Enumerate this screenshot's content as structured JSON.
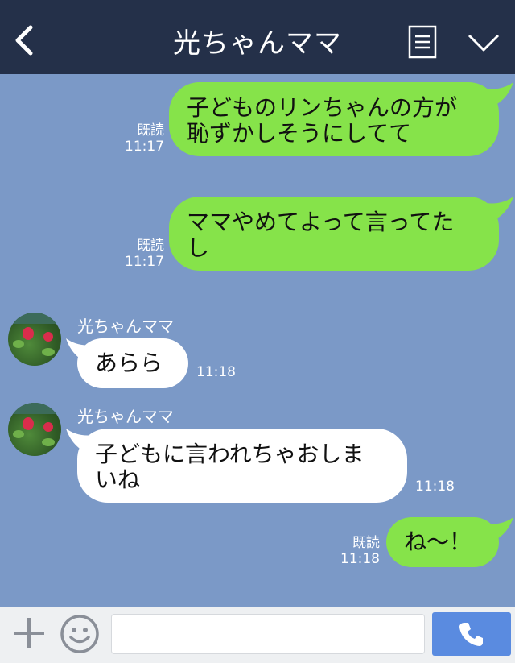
{
  "header": {
    "title": "光ちゃんママ",
    "back_icon": "chevron-left-icon",
    "menu_icon": "list-icon",
    "collapse_icon": "chevron-down-icon",
    "background": "#243049"
  },
  "colors": {
    "chat_background": "#7b99c7",
    "outgoing_bubble": "#86e34a",
    "incoming_bubble": "#ffffff",
    "call_button": "#5a8be0"
  },
  "messages": [
    {
      "direction": "out",
      "line1": "子どものリンちゃんの方が",
      "line2": "恥ずかしそうにしてて",
      "read": "既読",
      "time": "11:17"
    },
    {
      "direction": "out",
      "line1": "ママやめてよって言ってた",
      "line2": "し",
      "read": "既読",
      "time": "11:17"
    },
    {
      "direction": "in",
      "sender": "光ちゃんママ",
      "line1": "あらら",
      "time": "11:18"
    },
    {
      "direction": "in",
      "sender": "光ちゃんママ",
      "line1": "子どもに言われちゃおしま",
      "line2": "いね",
      "time": "11:18"
    },
    {
      "direction": "out",
      "line1": "ね〜！",
      "read": "既読",
      "time": "11:18"
    }
  ],
  "input_bar": {
    "add_icon": "plus-icon",
    "emoji_icon": "smile-icon",
    "message_value": "",
    "call_icon": "phone-icon"
  }
}
